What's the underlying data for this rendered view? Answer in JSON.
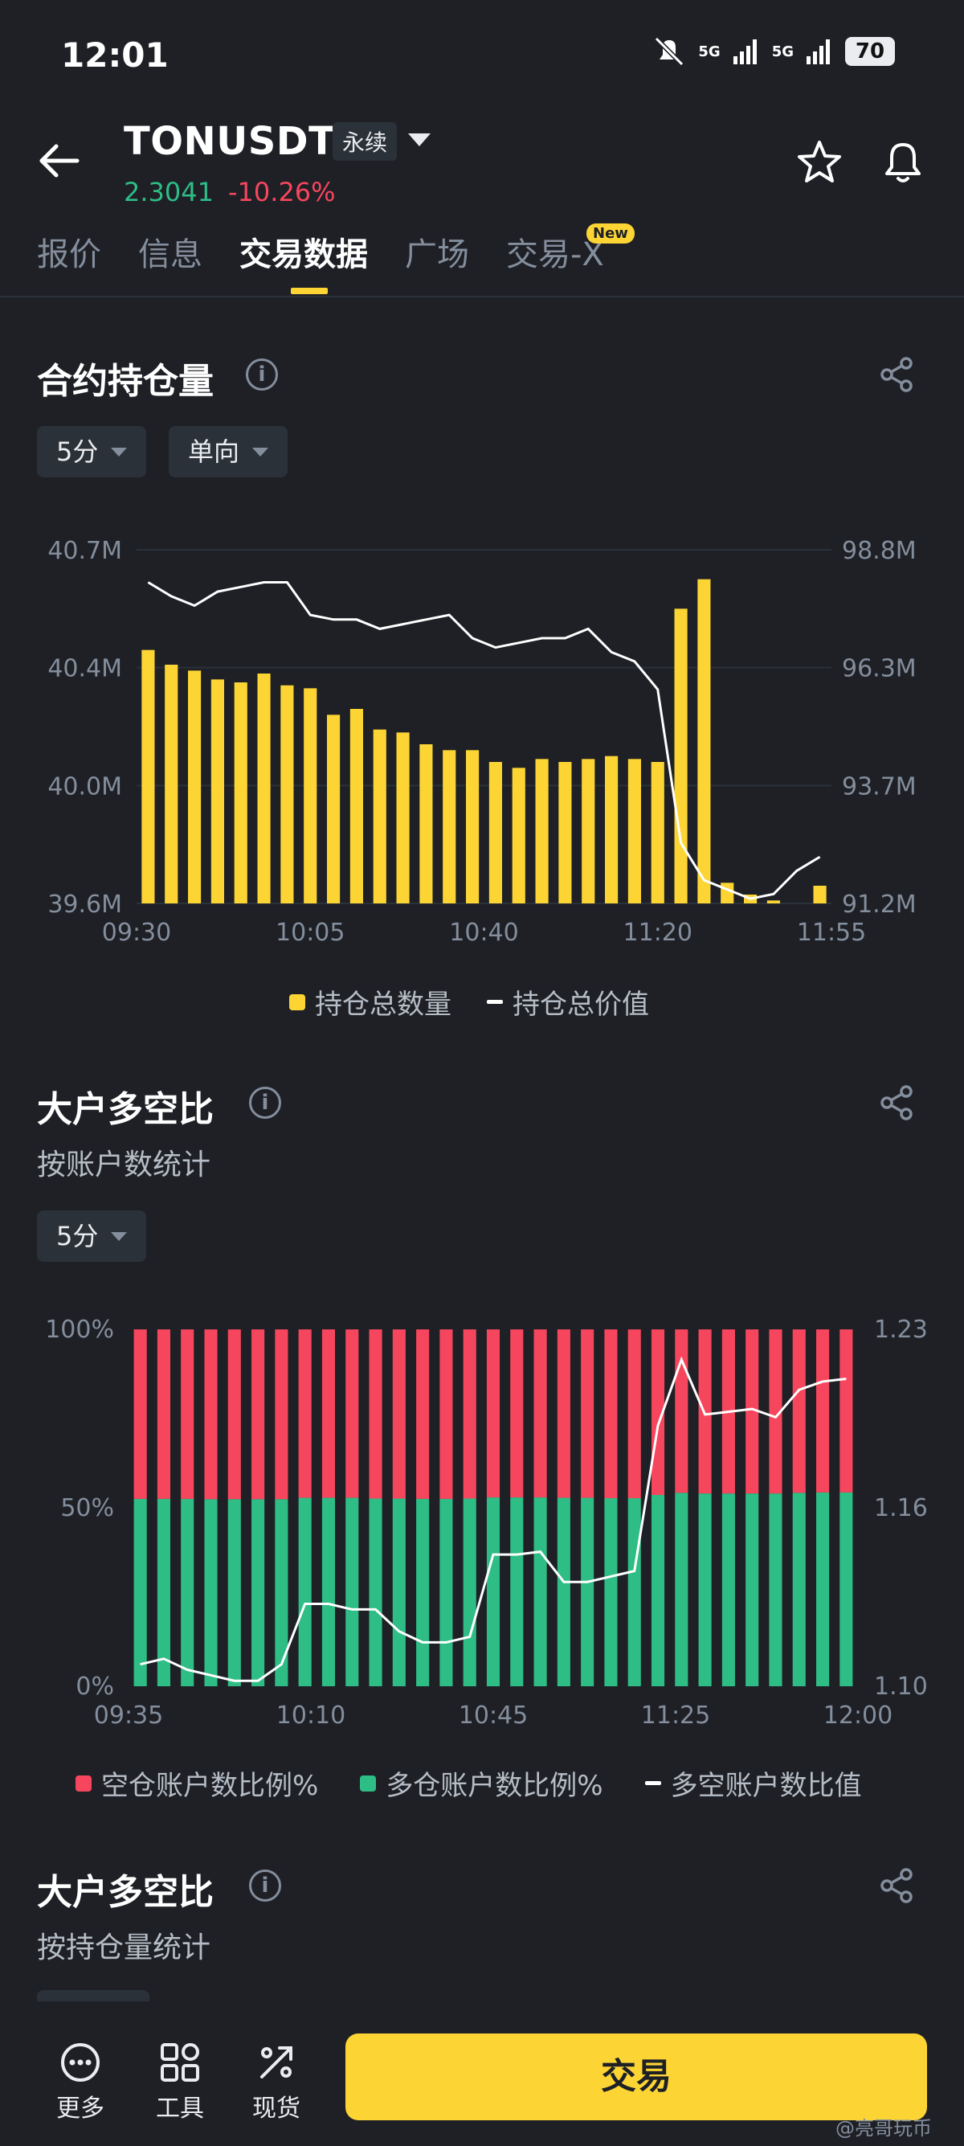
{
  "status_bar": {
    "time": "12:01",
    "signal_1": "5G",
    "signal_2": "5G",
    "battery": "70"
  },
  "header": {
    "symbol": "TONUSDT",
    "contract_type": "永续",
    "price": "2.3041",
    "change": "-10.26%"
  },
  "tabs": [
    {
      "label": "报价"
    },
    {
      "label": "信息"
    },
    {
      "label": "交易数据"
    },
    {
      "label": "广场"
    },
    {
      "label": "交易-X"
    }
  ],
  "new_badge": "New",
  "section1": {
    "title": "合约持仓量",
    "interval": "5分",
    "mode": "单向",
    "legend": {
      "bars": "持仓总数量",
      "line": "持仓总价值"
    }
  },
  "section2": {
    "title": "大户多空比",
    "subtitle": "按账户数统计",
    "interval": "5分",
    "legend": {
      "short": "空仓账户数比例%",
      "long": "多仓账户数比例%",
      "ratio": "多空账户数比值"
    }
  },
  "section3": {
    "title": "大户多空比",
    "subtitle": "按持仓量统计"
  },
  "bottom_nav": {
    "more": "更多",
    "tools": "工具",
    "spot": "现货",
    "trade": "交易"
  },
  "watermark": "@亮哥玩币",
  "colors": {
    "accent": "#fcd535",
    "up": "#2ebd85",
    "down": "#f6465d",
    "background": "#1e2026"
  },
  "chart_data": [
    {
      "type": "bar",
      "title": "合约持仓量",
      "x_tick_labels": [
        "09:30",
        "10:05",
        "10:40",
        "11:20",
        "11:55"
      ],
      "y_left_ticks": [
        "39.6M",
        "40.0M",
        "40.4M",
        "40.7M"
      ],
      "y_right_ticks": [
        "91.2M",
        "93.7M",
        "96.3M",
        "98.8M"
      ],
      "ylim_left": [
        39.6,
        40.8
      ],
      "ylim_right": [
        91.2,
        98.8
      ],
      "series": [
        {
          "name": "持仓总数量",
          "type": "bar",
          "axis": "left",
          "color": "#fcd535",
          "values": [
            40.46,
            40.41,
            40.39,
            40.36,
            40.35,
            40.38,
            40.34,
            40.33,
            40.24,
            40.26,
            40.19,
            40.18,
            40.14,
            40.12,
            40.12,
            40.08,
            40.06,
            40.09,
            40.08,
            40.09,
            40.1,
            40.09,
            40.08,
            40.6,
            40.7,
            39.67,
            39.63,
            39.61,
            39.59,
            39.66
          ]
        },
        {
          "name": "持仓总价值",
          "type": "line",
          "axis": "right",
          "color": "#ffffff",
          "values": [
            98.1,
            97.8,
            97.6,
            97.9,
            98.0,
            98.1,
            98.1,
            97.4,
            97.3,
            97.3,
            97.1,
            97.2,
            97.3,
            97.4,
            96.9,
            96.7,
            96.8,
            96.9,
            96.9,
            97.1,
            96.6,
            96.4,
            95.8,
            92.5,
            91.7,
            91.5,
            91.3,
            91.4,
            91.9,
            92.2
          ]
        }
      ]
    },
    {
      "type": "bar",
      "title": "大户多空比",
      "x_tick_labels": [
        "09:35",
        "10:10",
        "10:45",
        "11:25",
        "12:00"
      ],
      "y_left_ticks": [
        "0%",
        "50%",
        "100%"
      ],
      "y_right_ticks": [
        "1.10",
        "1.16",
        "1.23"
      ],
      "ylim_left": [
        0,
        100
      ],
      "ylim_right": [
        1.1,
        1.23
      ],
      "series": [
        {
          "name": "多仓账户数比例%",
          "type": "stacked-bar",
          "color": "#2ebd85",
          "values": [
            52.5,
            52.5,
            52.5,
            52.4,
            52.4,
            52.4,
            52.4,
            52.8,
            52.8,
            52.8,
            52.6,
            52.6,
            52.5,
            52.5,
            52.6,
            52.9,
            52.9,
            52.9,
            52.8,
            52.8,
            52.7,
            52.7,
            53.6,
            54.2,
            54.0,
            54.0,
            54.0,
            54.0,
            54.2,
            54.3,
            54.3
          ]
        },
        {
          "name": "空仓账户数比例%",
          "type": "stacked-bar",
          "color": "#f6465d",
          "values": [
            47.5,
            47.5,
            47.5,
            47.6,
            47.6,
            47.6,
            47.6,
            47.2,
            47.2,
            47.2,
            47.4,
            47.4,
            47.5,
            47.5,
            47.4,
            47.1,
            47.1,
            47.1,
            47.2,
            47.2,
            47.3,
            47.3,
            46.4,
            45.8,
            46.0,
            46.0,
            46.0,
            46.0,
            45.8,
            45.7,
            45.7
          ]
        },
        {
          "name": "多空账户数比值",
          "type": "line",
          "color": "#ffffff",
          "values": [
            1.108,
            1.11,
            1.106,
            1.104,
            1.102,
            1.102,
            1.108,
            1.13,
            1.13,
            1.128,
            1.128,
            1.12,
            1.116,
            1.116,
            1.118,
            1.148,
            1.148,
            1.149,
            1.138,
            1.138,
            1.14,
            1.142,
            1.195,
            1.219,
            1.199,
            1.2,
            1.201,
            1.198,
            1.208,
            1.211,
            1.212
          ]
        }
      ]
    }
  ]
}
